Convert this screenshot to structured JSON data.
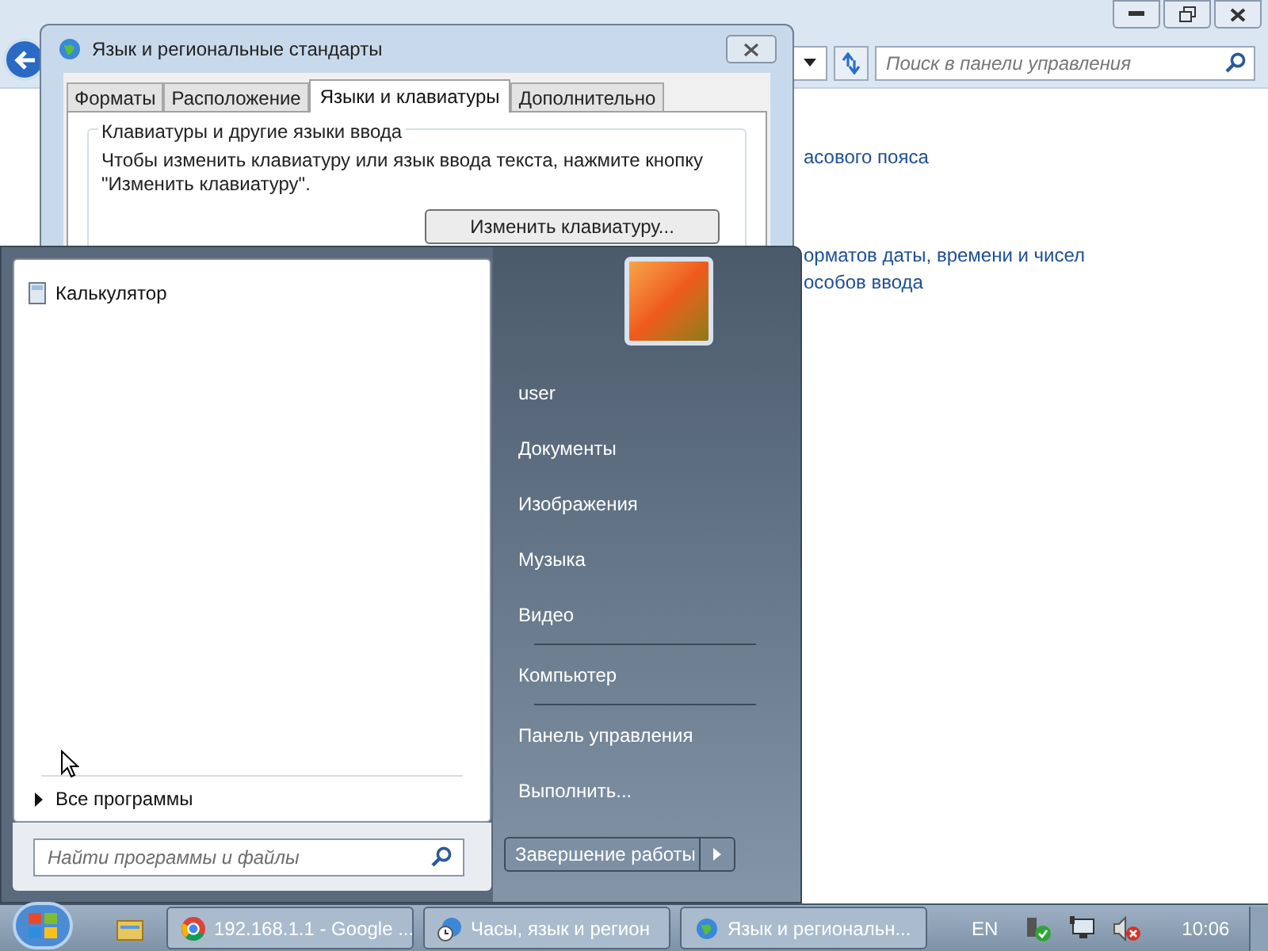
{
  "control_panel": {
    "search_placeholder": "Поиск в панели управления",
    "links": [
      "асового пояса",
      "орматов даты, времени и чисел",
      "особов ввода"
    ]
  },
  "dialog": {
    "title": "Язык и региональные стандарты",
    "tabs": [
      {
        "label": "Форматы",
        "selected": false
      },
      {
        "label": "Расположение",
        "selected": false
      },
      {
        "label": "Языки и клавиатуры",
        "selected": true
      },
      {
        "label": "Дополнительно",
        "selected": false
      }
    ],
    "group_title": "Клавиатуры и другие языки ввода",
    "description": "Чтобы изменить клавиатуру или язык ввода текста, нажмите кнопку \"Изменить клавиатуру\".",
    "button": "Изменить клавиатуру..."
  },
  "start_menu": {
    "programs": [
      {
        "label": "Калькулятор"
      }
    ],
    "all_programs": "Все программы",
    "search_placeholder": "Найти программы и файлы",
    "place_groups": [
      [
        "user",
        "Документы",
        "Изображения",
        "Музыка",
        "Видео"
      ],
      [
        "Компьютер"
      ],
      [
        "Панель управления",
        "Выполнить..."
      ]
    ],
    "shutdown": "Завершение работы"
  },
  "taskbar": {
    "buttons": [
      {
        "label": "192.168.1.1 - Google ...",
        "kind": "browser"
      },
      {
        "label": "Часы, язык и регион",
        "kind": "globe-clock"
      },
      {
        "label": "Язык и региональн...",
        "kind": "globe"
      }
    ],
    "language": "EN",
    "clock": "10:06"
  }
}
